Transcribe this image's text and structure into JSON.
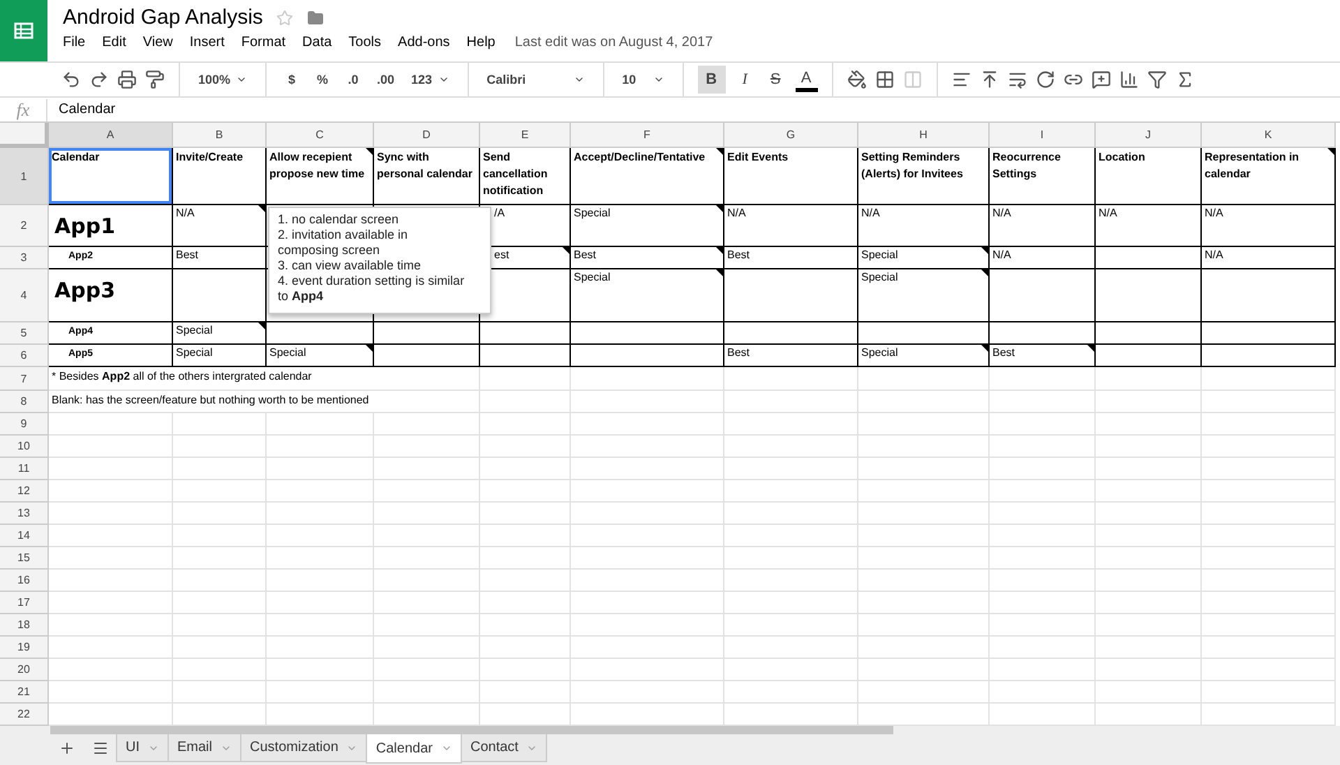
{
  "document": {
    "title": "Android Gap Analysis",
    "last_edit": "Last edit was on August 4, 2017"
  },
  "menu": [
    "File",
    "Edit",
    "View",
    "Insert",
    "Format",
    "Data",
    "Tools",
    "Add-ons",
    "Help"
  ],
  "toolbar": {
    "zoom": "100%",
    "currency": "$",
    "percent": "%",
    "decrease_decimals": ".0",
    "increase_decimals": ".00",
    "more_formats": "123",
    "font": "Calibri",
    "font_size": "10",
    "bold": {
      "label": "B",
      "on": true
    },
    "italic": {
      "label": "I",
      "on": false
    },
    "strikethrough": {
      "label": "S",
      "on": false
    },
    "text_color": {
      "label": "A",
      "color": "#000000"
    }
  },
  "formula_bar": {
    "label": "fx",
    "value": "Calendar"
  },
  "columns": [
    {
      "letter": "A",
      "selected": true
    },
    {
      "letter": "B",
      "selected": false
    },
    {
      "letter": "C",
      "selected": false
    },
    {
      "letter": "D",
      "selected": false
    },
    {
      "letter": "E",
      "selected": false
    },
    {
      "letter": "F",
      "selected": false
    },
    {
      "letter": "G",
      "selected": false
    },
    {
      "letter": "H",
      "selected": false
    },
    {
      "letter": "I",
      "selected": false
    },
    {
      "letter": "J",
      "selected": false
    },
    {
      "letter": "K",
      "selected": false
    }
  ],
  "rows": [
    {
      "number": "1",
      "kind": "data",
      "selected": true,
      "cells": [
        {
          "kind": "header",
          "text": "Calendar",
          "note": false
        },
        {
          "kind": "header",
          "text": "Invite/Create",
          "note": false
        },
        {
          "kind": "header",
          "text": "Allow recepient propose new time",
          "note": true
        },
        {
          "kind": "header",
          "text": "Sync with personal calendar",
          "note": false
        },
        {
          "kind": "header",
          "text": "Send cancellation notification",
          "note": false
        },
        {
          "kind": "header",
          "text": "Accept/Decline/Tentative",
          "note": true
        },
        {
          "kind": "header",
          "text": "Edit Events",
          "note": false
        },
        {
          "kind": "header",
          "text": "Setting Reminders (Alerts) for Invitees",
          "note": false
        },
        {
          "kind": "header",
          "text": "Reocurrence Settings",
          "note": false
        },
        {
          "kind": "header",
          "text": "Location",
          "note": false
        },
        {
          "kind": "header",
          "text": "Representation in calendar",
          "note": true
        }
      ]
    },
    {
      "number": "2",
      "kind": "data",
      "selected": false,
      "cells": [
        {
          "kind": "app_large",
          "text": "App1",
          "note": false
        },
        {
          "kind": "text",
          "text": "N/A",
          "note": true
        },
        null,
        null,
        {
          "kind": "partly_covered",
          "text": "/A",
          "note": false
        },
        {
          "kind": "text",
          "text": "Special",
          "note": true
        },
        {
          "kind": "text",
          "text": "N/A",
          "note": false
        },
        {
          "kind": "text",
          "text": "N/A",
          "note": false
        },
        {
          "kind": "text",
          "text": "N/A",
          "note": false
        },
        {
          "kind": "text",
          "text": "N/A",
          "note": false
        },
        {
          "kind": "text",
          "text": "N/A",
          "note": false
        }
      ]
    },
    {
      "number": "3",
      "kind": "data",
      "selected": false,
      "cells": [
        {
          "kind": "app_small",
          "text": "App2",
          "note": false
        },
        {
          "kind": "text",
          "text": "Best",
          "note": false
        },
        null,
        null,
        {
          "kind": "partly_covered",
          "text": "est",
          "note": true
        },
        {
          "kind": "text",
          "text": "Best",
          "note": true
        },
        {
          "kind": "text",
          "text": "Best",
          "note": false
        },
        {
          "kind": "text",
          "text": "Special",
          "note": true
        },
        {
          "kind": "text",
          "text": "N/A",
          "note": false
        },
        null,
        {
          "kind": "text",
          "text": "N/A",
          "note": false
        }
      ]
    },
    {
      "number": "4",
      "kind": "data",
      "selected": false,
      "cells": [
        {
          "kind": "app_large",
          "text": "App3",
          "note": false
        },
        null,
        null,
        null,
        null,
        {
          "kind": "text",
          "text": "Special",
          "note": true
        },
        null,
        {
          "kind": "text",
          "text": "Special",
          "note": true
        },
        null,
        null,
        null
      ]
    },
    {
      "number": "5",
      "kind": "data",
      "selected": false,
      "cells": [
        {
          "kind": "app_small",
          "text": "App4",
          "note": false
        },
        {
          "kind": "text",
          "text": "Special",
          "note": true
        },
        null,
        null,
        null,
        null,
        null,
        null,
        null,
        null,
        null
      ]
    },
    {
      "number": "6",
      "kind": "data",
      "selected": false,
      "cells": [
        {
          "kind": "app_small",
          "text": "App5",
          "note": false
        },
        {
          "kind": "text",
          "text": "Special",
          "note": false
        },
        {
          "kind": "text",
          "text": "Special",
          "note": true
        },
        null,
        null,
        null,
        {
          "kind": "text",
          "text": "Best",
          "note": false
        },
        {
          "kind": "text",
          "text": "Special",
          "note": true
        },
        {
          "kind": "text",
          "text": "Best",
          "note": true
        },
        null,
        null
      ]
    },
    {
      "number": "7",
      "kind": "plain",
      "selected": false,
      "cells": [
        {
          "kind": "overflow",
          "text": "* Besides **App2** all of the others intergrated calendar",
          "note": false
        }
      ]
    },
    {
      "number": "8",
      "kind": "plain",
      "selected": false,
      "cells": [
        {
          "kind": "overflow",
          "text": "Blank: has the screen/feature but nothing worth to be mentioned",
          "note": false
        }
      ]
    },
    {
      "number": "9",
      "kind": "plain",
      "selected": false
    },
    {
      "number": "10",
      "kind": "plain",
      "selected": false
    },
    {
      "number": "11",
      "kind": "plain",
      "selected": false
    },
    {
      "number": "12",
      "kind": "plain",
      "selected": false
    },
    {
      "number": "13",
      "kind": "plain",
      "selected": false
    },
    {
      "number": "14",
      "kind": "plain",
      "selected": false
    },
    {
      "number": "15",
      "kind": "plain",
      "selected": false
    },
    {
      "number": "16",
      "kind": "plain",
      "selected": false
    },
    {
      "number": "17",
      "kind": "plain",
      "selected": false
    },
    {
      "number": "18",
      "kind": "plain",
      "selected": false
    },
    {
      "number": "19",
      "kind": "plain",
      "selected": false
    },
    {
      "number": "20",
      "kind": "plain",
      "selected": false
    },
    {
      "number": "21",
      "kind": "plain",
      "selected": false
    },
    {
      "number": "22",
      "kind": "plain",
      "selected": false
    }
  ],
  "note_popup": {
    "lines": [
      "1. no calendar screen",
      "2. invitation available in composing screen",
      "3. can view available time",
      "4. event duration setting is similar to **App4**"
    ]
  },
  "sheet_tabs": [
    {
      "label": "UI",
      "selected": false
    },
    {
      "label": "Email",
      "selected": false
    },
    {
      "label": "Customization",
      "selected": false
    },
    {
      "label": "Calendar",
      "selected": true
    },
    {
      "label": "Contact",
      "selected": false
    }
  ]
}
